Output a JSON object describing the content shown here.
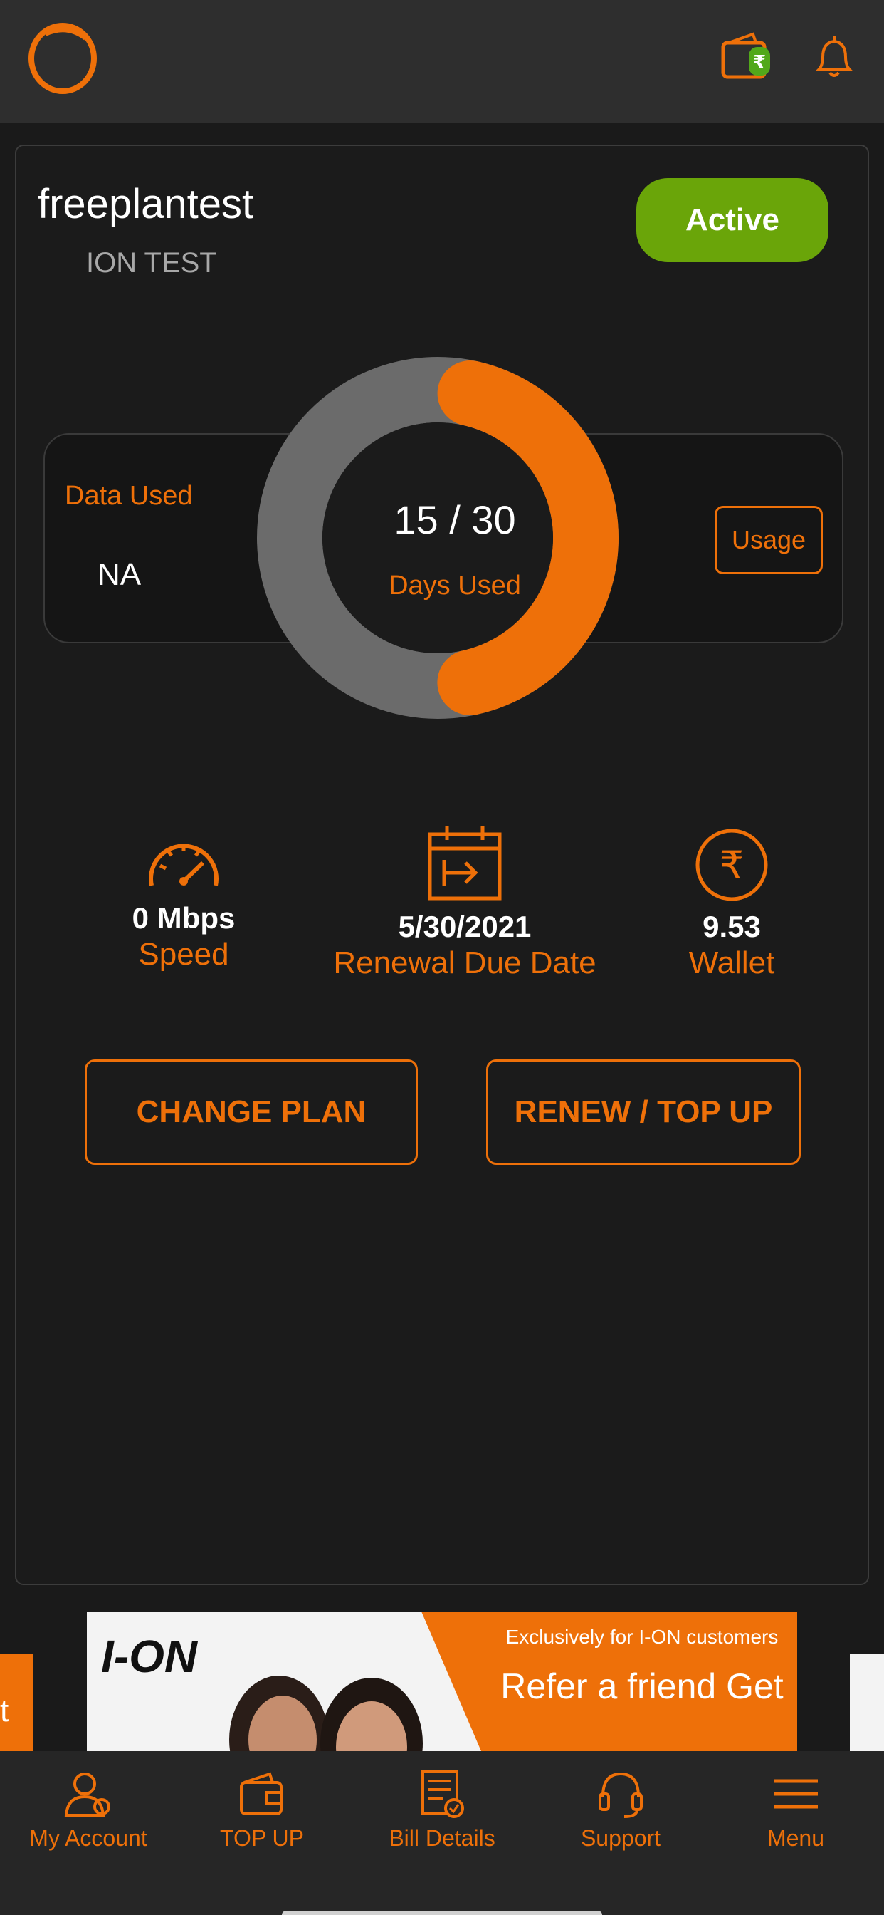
{
  "header": {
    "wallet_icon": "wallet-rupee-icon",
    "bell_icon": "bell-icon"
  },
  "account": {
    "username": "freeplantest",
    "plan_name": "ION TEST",
    "status": "Active"
  },
  "usage": {
    "data_used_label": "Data Used",
    "data_used_value": "NA",
    "usage_button": "Usage",
    "days_used_text": "15 / 30",
    "days_used_label": "Days Used",
    "days_used": 15,
    "days_total": 30
  },
  "stats": {
    "speed_value": "0 Mbps",
    "speed_label": "Speed",
    "renewal_value": "5/30/2021",
    "renewal_label": "Renewal Due Date",
    "wallet_value": "9.53",
    "wallet_label": "Wallet"
  },
  "actions": {
    "change_plan": "CHANGE PLAN",
    "renew_topup": "RENEW / TOP UP"
  },
  "banner": {
    "brand": "I-ON",
    "tagline_small": "Exclusively for I-ON customers",
    "tagline_big": "Refer a friend Get",
    "left_peek_text": "t"
  },
  "nav": [
    {
      "label": "My Account",
      "icon": "account-icon"
    },
    {
      "label": "TOP UP",
      "icon": "wallet-icon"
    },
    {
      "label": "Bill Details",
      "icon": "bill-icon"
    },
    {
      "label": "Support",
      "icon": "headset-icon"
    },
    {
      "label": "Menu",
      "icon": "menu-icon"
    }
  ],
  "colors": {
    "accent": "#ee7009",
    "active_green": "#6aa509",
    "donut_track": "#6b6b6b"
  }
}
